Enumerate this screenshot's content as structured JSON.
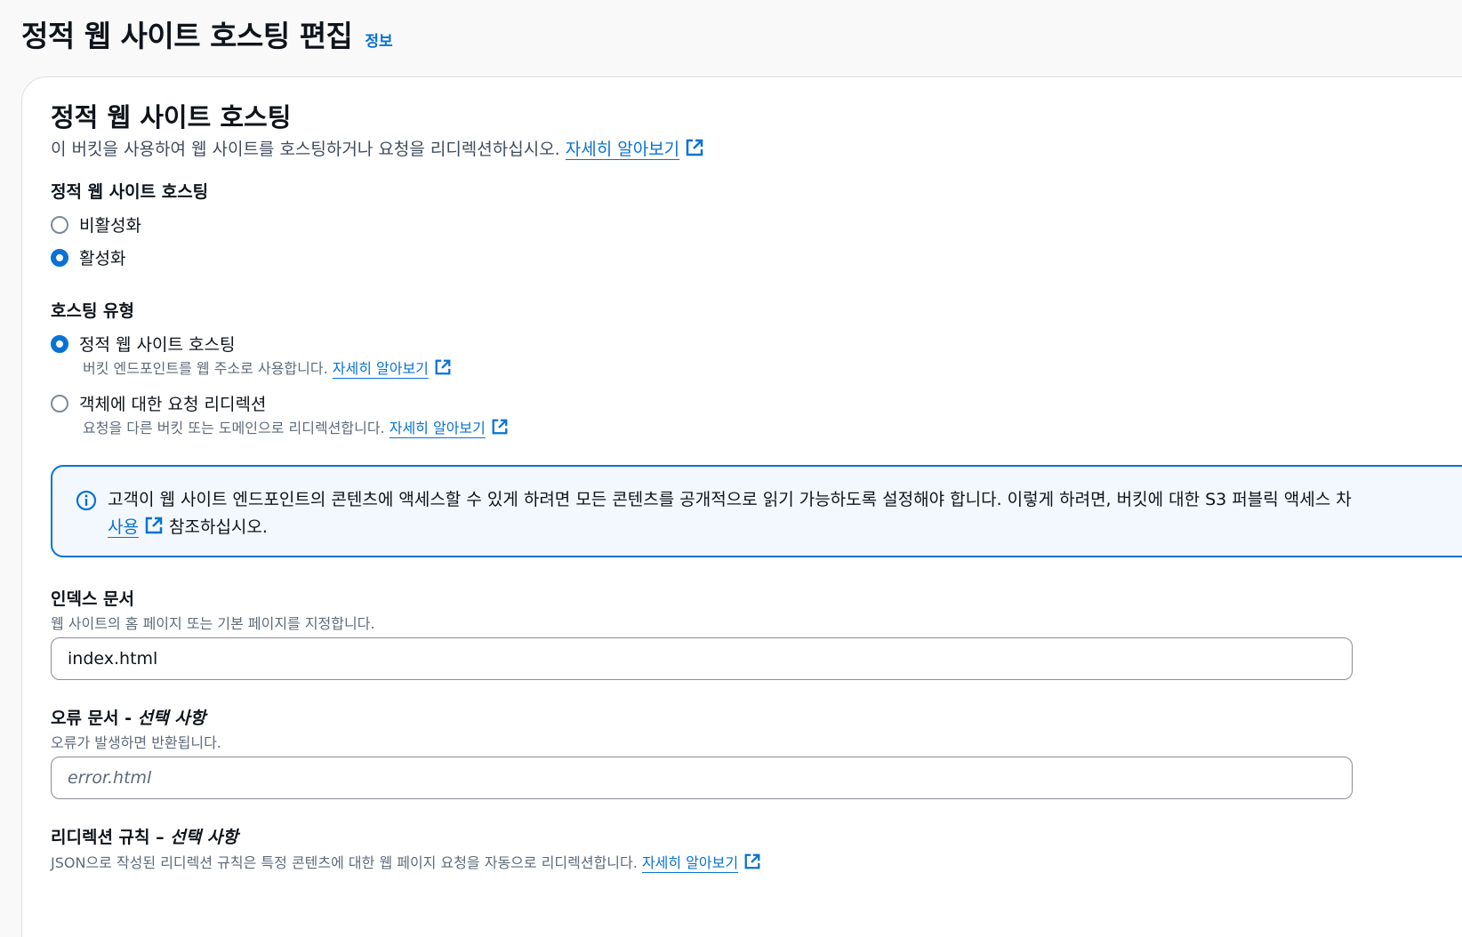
{
  "header": {
    "title": "정적 웹 사이트 호스팅 편집",
    "info_link": "정보"
  },
  "panel": {
    "title": "정적 웹 사이트 호스팅",
    "description": "이 버킷을 사용하여 웹 사이트를 호스팅하거나 요청을 리디렉션하십시오.",
    "learn_more": "자세히 알아보기",
    "hosting_toggle": {
      "label": "정적 웹 사이트 호스팅",
      "options": [
        {
          "label": "비활성화",
          "selected": false
        },
        {
          "label": "활성화",
          "selected": true
        }
      ]
    },
    "hosting_type": {
      "label": "호스팅 유형",
      "options": [
        {
          "label": "정적 웹 사이트 호스팅",
          "hint": "버킷 엔드포인트를 웹 주소로 사용합니다.",
          "link": "자세히 알아보기",
          "selected": true
        },
        {
          "label": "객체에 대한 요청 리디렉션",
          "hint": "요청을 다른 버킷 또는 도메인으로 리디렉션합니다.",
          "link": "자세히 알아보기",
          "selected": false
        }
      ]
    },
    "alert": {
      "text_before": "고객이 웹 사이트 엔드포인트의 콘텐츠에 액세스할 수 있게 하려면 모든 콘텐츠를 공개적으로 읽기 가능하도록 설정해야 합니다. 이렇게 하려면, 버킷에 대한 S3 퍼블릭 액세스 차",
      "link": "사용",
      "text_after": "참조하십시오."
    },
    "index_document": {
      "label": "인덱스 문서",
      "hint": "웹 사이트의 홈 페이지 또는 기본 페이지를 지정합니다.",
      "value": "index.html"
    },
    "error_document": {
      "label": "오류 문서 - ",
      "label_optional": "선택 사항",
      "hint": "오류가 발생하면 반환됩니다.",
      "placeholder": "error.html"
    },
    "redirect_rules": {
      "label": "리디렉션 규칙 – ",
      "label_optional": "선택 사항",
      "hint": "JSON으로 작성된 리디렉션 규칙은 특정 콘텐츠에 대한 웹 페이지 요청을 자동으로 리디렉션합니다.",
      "link": "자세히 알아보기"
    }
  },
  "colors": {
    "accent": "#0972d3",
    "text": "#0f141a",
    "muted": "#5f6b7a",
    "background": "#f9f9fa"
  }
}
